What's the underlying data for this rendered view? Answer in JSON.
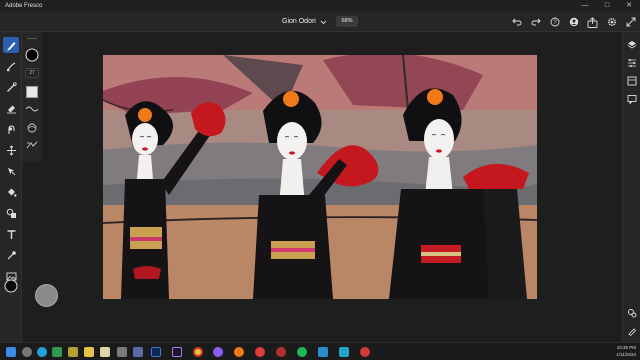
{
  "window": {
    "title": "Adobe Fresco"
  },
  "window_controls": [
    "minimize-icon",
    "maximize-icon",
    "close-icon"
  ],
  "header": {
    "doc_title": "Gion Odori",
    "zoom": "68%",
    "icons": [
      "undo-icon",
      "redo-icon",
      "help-icon",
      "account-icon",
      "share-icon",
      "settings-icon",
      "fullscreen-icon"
    ]
  },
  "left_tools": [
    "pixel-brush-icon",
    "live-brush-icon",
    "vector-brush-icon",
    "eraser-icon",
    "smudge-icon",
    "transform-icon",
    "selection-icon",
    "fill-icon",
    "shapes-icon",
    "text-icon",
    "eyedropper-icon",
    "image-icon",
    "color-icon"
  ],
  "brush_props": {
    "size": "27"
  },
  "right_tools": [
    "layers-icon",
    "layer-properties-icon",
    "libraries-icon",
    "comments-icon",
    "history-icon",
    "draw-modifier-icon"
  ],
  "taskbar": {
    "apps": [
      "start-icon",
      "search-icon",
      "edge-icon",
      "app-icon",
      "app-icon",
      "file-explorer-icon",
      "store-icon",
      "fresco-icon",
      "media-encoder-icon",
      "chrome-icon",
      "firefox-icon",
      "app-icon",
      "opera-icon",
      "app-icon",
      "spotify-icon",
      "app-icon",
      "steam-icon",
      "app-icon",
      "app-icon"
    ],
    "time": "10:35 PM",
    "date": "1/11/2024"
  }
}
